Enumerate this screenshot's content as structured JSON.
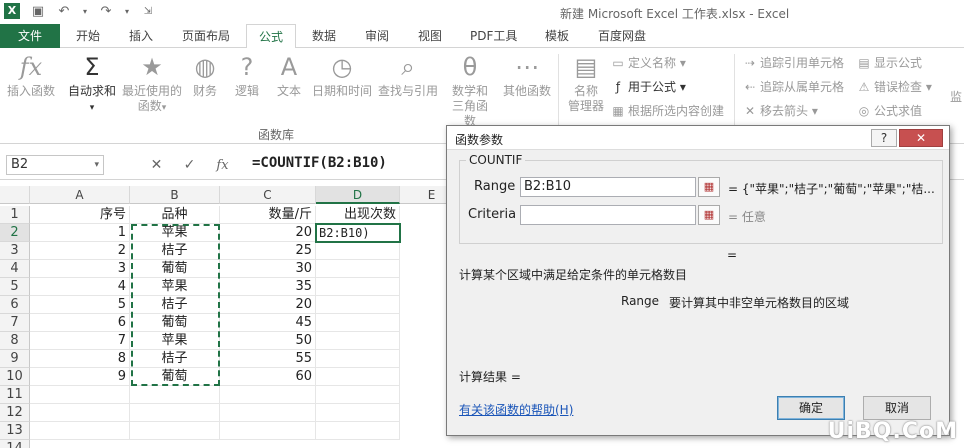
{
  "window": {
    "title": "新建 Microsoft Excel 工作表.xlsx - Excel"
  },
  "qat": {
    "save_icon": "save-icon",
    "undo_icon": "undo-icon",
    "redo_icon": "redo-icon"
  },
  "tabs": [
    "文件",
    "开始",
    "插入",
    "页面布局",
    "公式",
    "数据",
    "审阅",
    "视图",
    "PDF工具",
    "模板",
    "百度网盘"
  ],
  "active_tab": "公式",
  "ribbon": {
    "insert_fn": "插入函数",
    "autosum": "自动求和",
    "recent": "最近使用的",
    "recent2": "函数",
    "finance": "财务",
    "logic": "逻辑",
    "text": "文本",
    "datetime": "日期和时间",
    "lookup": "查找与引用",
    "math": "数学和",
    "math2": "三角函数",
    "other": "其他函数",
    "group_label": "函数库",
    "name_mgr": "名称",
    "name_mgr2": "管理器",
    "define_name": "定义名称",
    "use_in_formula": "用于公式",
    "create_from_sel": "根据所选内容创建",
    "trace_prec": "追踪引用单元格",
    "trace_dep": "追踪从属单元格",
    "remove_arrows": "移去箭头",
    "show_formulas": "显示公式",
    "error_check": "错误检查",
    "eval_formula": "公式求值",
    "watch_partial": "监"
  },
  "formula_bar": {
    "name_box": "B2",
    "cancel": "✕",
    "enter": "✓",
    "fx": "fx",
    "formula": "=COUNTIF(B2:B10)"
  },
  "columns": [
    "A",
    "B",
    "C",
    "D",
    "E"
  ],
  "rows": [
    "1",
    "2",
    "3",
    "4",
    "5",
    "6",
    "7",
    "8",
    "9",
    "10",
    "11",
    "12",
    "13",
    "14"
  ],
  "table": {
    "headers": [
      "序号",
      "品种",
      "数量/斤",
      "出现次数"
    ],
    "data": [
      [
        "1",
        "苹果",
        "20"
      ],
      [
        "2",
        "桔子",
        "25"
      ],
      [
        "3",
        "葡萄",
        "30"
      ],
      [
        "4",
        "苹果",
        "35"
      ],
      [
        "5",
        "桔子",
        "20"
      ],
      [
        "6",
        "葡萄",
        "45"
      ],
      [
        "7",
        "苹果",
        "50"
      ],
      [
        "8",
        "桔子",
        "55"
      ],
      [
        "9",
        "葡萄",
        "60"
      ]
    ],
    "edit_cell": "B2:B10)"
  },
  "dialog": {
    "title": "函数参数",
    "help_btn": "?",
    "close_btn": "✕",
    "function_name": "COUNTIF",
    "arg1_label": "Range",
    "arg1_value": "B2:B10",
    "arg1_result": "=  {\"苹果\";\"桔子\";\"葡萄\";\"苹果\";\"桔...",
    "arg2_label": "Criteria",
    "arg2_value": "",
    "arg2_result": "=  任意",
    "formula_result_eq": "=",
    "description": "计算某个区域中满足给定条件的单元格数目",
    "arg_help_name": "Range",
    "arg_help_text": "要计算其中非空单元格数目的区域",
    "calc_result": "计算结果 =",
    "help_link": "有关该函数的帮助(H)",
    "ok": "确定",
    "cancel": "取消"
  },
  "watermark": "UiBQ.CoM"
}
